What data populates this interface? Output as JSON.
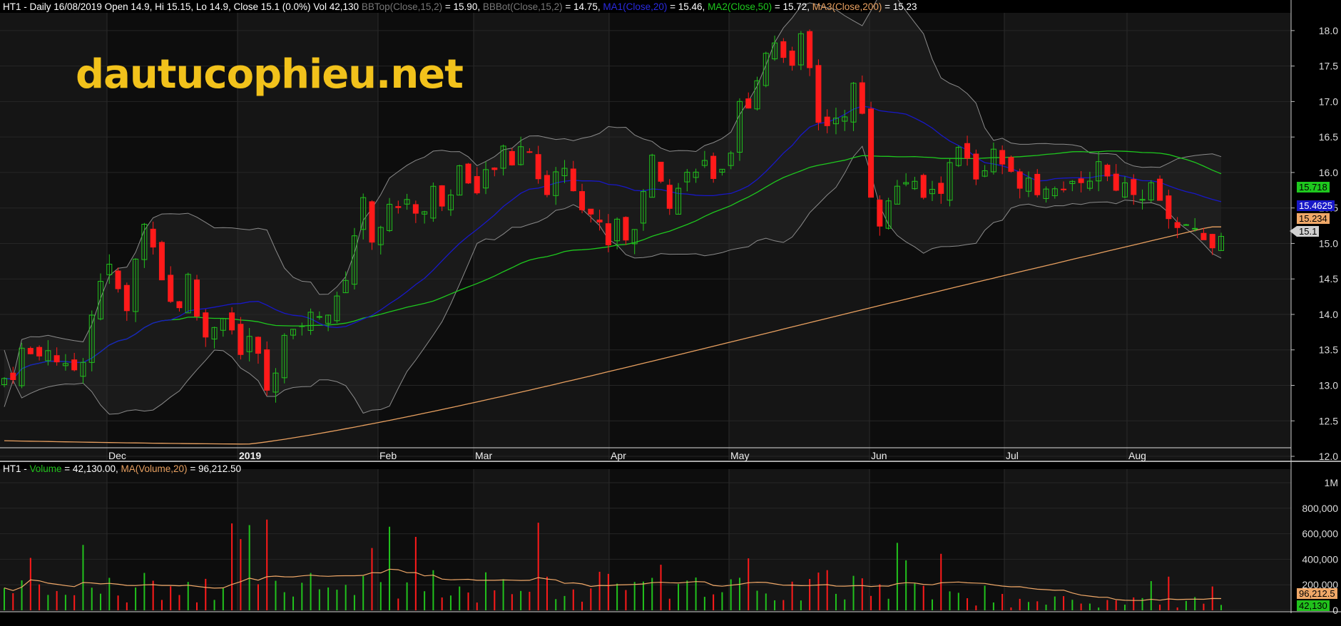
{
  "header": {
    "symbol": "HT1 - Daily 16/08/2019 Open 14.9, Hi 15.15, Lo 14.9, Close 15.1 (0.0%) Vol 42,130",
    "bbtop_label": "BBTop(Close,15,2)",
    "bbtop_value": " = 15.90,",
    "bbbot_label": "BBBot(Close,15,2)",
    "bbbot_value": " = 14.75,",
    "ma1_label": "MA1(Close,20)",
    "ma1_value": " = 15.46,",
    "ma2_label": "MA2(Close,50)",
    "ma2_value": " = 15.72,",
    "ma3_label": "MA3(Close,200)",
    "ma3_value": " = 15.23"
  },
  "volume_header": {
    "symbol": "HT1 - ",
    "vol_label": "Volume",
    "vol_value": " = 42,130.00,",
    "ma_label": "MA(Volume,20)",
    "ma_value": " = 96,212.50"
  },
  "watermark": "dautucophieu.net",
  "colors": {
    "up": "#21c21c",
    "down": "#ff1a1a",
    "bb": "#8a8a8a",
    "ma1": "#1818c8",
    "ma2": "#1ec81e",
    "ma3": "#e8a060",
    "vol_ma": "#f0a868"
  },
  "value_tags": {
    "ma2": "15.718",
    "ma1": "15.4625",
    "ma3": "15.234",
    "close": "15.1",
    "vol_ma": "96,212.5",
    "vol": "42,130"
  },
  "chart_data": {
    "type": "candlestick",
    "y_ticks": [
      "12.0",
      "12.5",
      "13.0",
      "13.5",
      "14.0",
      "14.5",
      "15.0",
      "15.5",
      "16.0",
      "16.5",
      "17.0",
      "17.5",
      "18.0"
    ],
    "ylim": [
      11.95,
      18.25
    ],
    "x_labels": [
      "Dec",
      "2019",
      "Feb",
      "Mar",
      "Apr",
      "May",
      "Jun",
      "Jul",
      "Aug"
    ],
    "volume_ticks": [
      "0",
      "200,000",
      "400,000",
      "600,000",
      "800,000",
      "1M"
    ],
    "volume_ylim": [
      0,
      1050000
    ],
    "series": [
      {
        "name": "HT1",
        "close_path": [
          13.1,
          13.2,
          13.6,
          13.3,
          13.6,
          13.4,
          13.2,
          13.25,
          13.5,
          14.4,
          14.7,
          14.4,
          14.0,
          14.9,
          15.4,
          14.8,
          14.2,
          14.1,
          14.5,
          13.9,
          13.6,
          14.1,
          13.9,
          13.4,
          13.7,
          13.3,
          12.8,
          13.7,
          13.6,
          13.9,
          13.95,
          14.1,
          14.0,
          14.3,
          15.0,
          15.6,
          15.1,
          15.3,
          15.6,
          15.5,
          15.6,
          15.3,
          15.9,
          15.4,
          15.9,
          16.2,
          15.6,
          15.9,
          16.1,
          16.3,
          16.1,
          16.6,
          16.0,
          15.7,
          16.0,
          16.1,
          15.7,
          15.5,
          15.3,
          15.0,
          15.4,
          15.0,
          15.3,
          16.3,
          15.9,
          15.6,
          15.8,
          16.0,
          16.2,
          16.0,
          15.9,
          16.1,
          17.0,
          16.8,
          17.6,
          17.9,
          17.8,
          17.4,
          17.9,
          17.3,
          16.4,
          17.0,
          16.6,
          17.2,
          16.8,
          15.4,
          15.3,
          15.8,
          15.9,
          15.8,
          15.65,
          15.7,
          15.8,
          16.4,
          16.2,
          15.9,
          16.1,
          16.3,
          16.0,
          15.85,
          16.0,
          15.8,
          15.75,
          15.9,
          15.8,
          15.7,
          15.9,
          16.2,
          15.9,
          15.8,
          15.85,
          15.7,
          15.8,
          15.7,
          15.3,
          15.1,
          15.2,
          15.15,
          15.05,
          15.1
        ]
      }
    ]
  }
}
